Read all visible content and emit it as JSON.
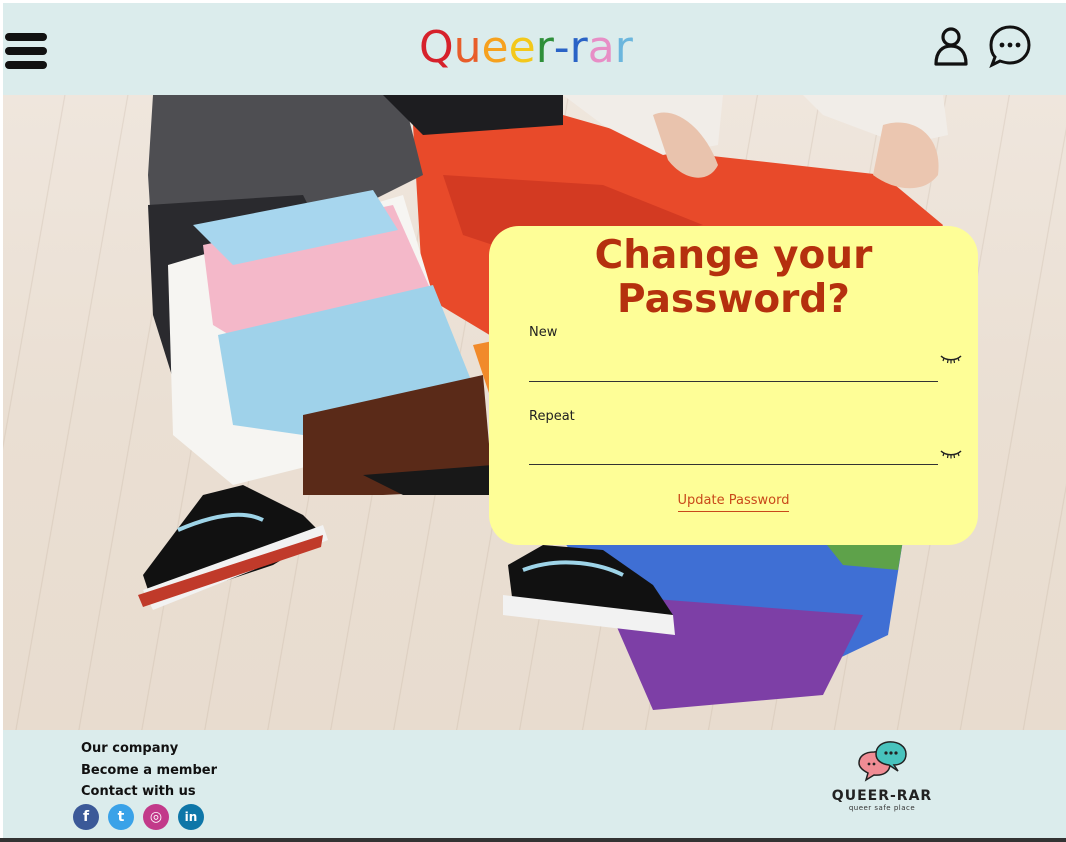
{
  "header": {
    "logo_letters": [
      {
        "ch": "Q",
        "color": "#d6212b"
      },
      {
        "ch": "u",
        "color": "#e85d2a"
      },
      {
        "ch": "e",
        "color": "#f6a11e"
      },
      {
        "ch": "e",
        "color": "#f3c81b"
      },
      {
        "ch": "r",
        "color": "#2f8f3a"
      },
      {
        "ch": "-",
        "color": "#2a63c6"
      },
      {
        "ch": "r",
        "color": "#2a63c6"
      },
      {
        "ch": "a",
        "color": "#e78ec6"
      },
      {
        "ch": "r",
        "color": "#6bb6dd"
      }
    ],
    "menu_icon": "hamburger-menu-icon",
    "user_icon": "user-icon",
    "chat_icon": "chat-bubble-icon"
  },
  "form": {
    "title": "Change your Password?",
    "new_label": "New",
    "new_value": "",
    "repeat_label": "Repeat",
    "repeat_value": "",
    "update_label": "Update Password"
  },
  "footer": {
    "links": [
      "Our company",
      "Become a member",
      "Contact with us"
    ],
    "socials": [
      {
        "icon": "facebook-icon",
        "glyph": "f",
        "color": "#3b5998"
      },
      {
        "icon": "twitter-icon",
        "glyph": "t",
        "color": "#3aa2e8"
      },
      {
        "icon": "instagram-icon",
        "glyph": "◎",
        "color": "#c23a8a"
      },
      {
        "icon": "linkedin-icon",
        "glyph": "in",
        "color": "#0e76a8"
      }
    ],
    "brand_name": "QUEER-RAR",
    "brand_tagline": "queer safe place"
  },
  "colors": {
    "header_bg": "#dbecec",
    "card_bg": "#fefe97",
    "title": "#b5300e",
    "link": "#c8481a"
  }
}
